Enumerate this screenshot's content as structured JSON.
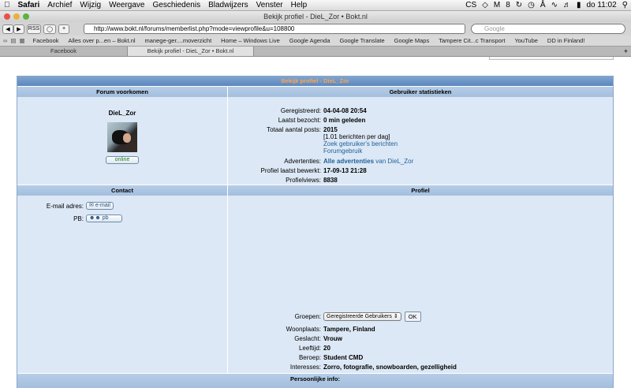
{
  "menubar": {
    "apple": "",
    "app": "Safari",
    "items": [
      "Archief",
      "Wijzig",
      "Weergave",
      "Geschiedenis",
      "Bladwijzers",
      "Venster",
      "Help"
    ],
    "battery": "8",
    "clock": "do 11:02"
  },
  "window": {
    "title": "Bekijk profiel - DieL_Zor • Bokt.nl"
  },
  "toolbar": {
    "back": "◀",
    "forward": "▶",
    "rss": "RSS",
    "add": "+",
    "url": "http://www.bokt.nl/forums/memberlist.php?mode=viewprofile&u=108800",
    "search_placeholder": "Google"
  },
  "bookmarks": [
    "Facebook",
    "Alles over p...en – Bokt.nl",
    "manege-ger....moverzicht",
    "Home – Windows Live",
    "Google Agenda",
    "Google Translate",
    "Google Maps",
    "Tampere Cit...c Transport",
    "YouTube",
    "DD in Finland!"
  ],
  "tabs": [
    {
      "label": "Facebook",
      "active": false
    },
    {
      "label": "Bekijk profiel - DieL_Zor • Bokt.nl",
      "active": true
    }
  ],
  "profile": {
    "title": "Bekijk profiel - DieL_Zor",
    "forum_header": "Forum voorkomen",
    "stats_header": "Gebruiker statistieken",
    "username": "DieL_Zor",
    "online": "online",
    "stats": {
      "registered_label": "Geregistreerd:",
      "registered": "04-04-08 20:54",
      "last_visit_label": "Laatst bezocht:",
      "last_visit": "0 min geleden",
      "posts_label": "Totaal aantal posts:",
      "posts": "2015",
      "posts_per_day": "[1.01 berichten per dag]",
      "search_posts": "Zoek gebruiker's berichten",
      "forum_usage": "Forumgebruik",
      "ads_label": "Advertenties:",
      "ads_link": "Alle advertenties",
      "ads_suffix": "van DieL_Zor",
      "edited_label": "Profiel laatst bewerkt:",
      "edited": "17-09-13 21:28",
      "views_label": "Profielviews:",
      "views": "8838"
    },
    "contact_header": "Contact",
    "profile_header": "Profiel",
    "contact": {
      "email_label": "E-mail adres:",
      "email_button": "e-mail",
      "pm_label": "PB:",
      "pm_button": "pb"
    },
    "details": {
      "groups_label": "Groepen:",
      "groups_value": "Geregistreerde Gebruikers",
      "ok": "OK",
      "location_label": "Woonplaats:",
      "location": "Tampere, Finland",
      "gender_label": "Geslacht:",
      "gender": "Vrouw",
      "age_label": "Leeftijd:",
      "age": "20",
      "job_label": "Beroep:",
      "job": "Student CMD",
      "interests_label": "Interesses:",
      "interests": "Zorro, fotografie, snowboarden, gezelligheid"
    },
    "personal_header": "Persoonlijke info:"
  },
  "colors": {
    "header_blue": "#5b87bd",
    "title_orange": "#ffa34f",
    "panel_bg": "#dce8f5",
    "link": "#1f5f9a"
  }
}
